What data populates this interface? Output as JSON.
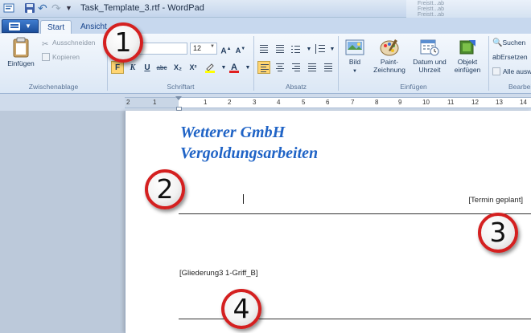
{
  "window": {
    "title": "Task_Template_3.rtf - WordPad",
    "bg_rows": [
      "Freistt...ab",
      "Freistt...ab",
      "Freistt...ab"
    ]
  },
  "quick_access": {
    "icons": [
      "wordpad-app-icon",
      "save-icon",
      "undo-icon",
      "redo-icon",
      "customize-dropdown-icon"
    ]
  },
  "tabs": {
    "start": "Start",
    "ansicht": "Ansicht"
  },
  "ribbon": {
    "clipboard": {
      "label": "Zwischenablage",
      "paste": "Einfügen",
      "cut": "Ausschneiden",
      "copy": "Kopieren"
    },
    "font": {
      "label": "Schriftart",
      "family": "",
      "size": "12",
      "bold": "F",
      "italic": "K",
      "underline": "U",
      "strike": "abc",
      "subscript": "X₂",
      "superscript": "X²",
      "grow": "A",
      "shrink": "A",
      "color_highlight": "#ffff00",
      "color_text": "#e02020"
    },
    "paragraph": {
      "label": "Absatz"
    },
    "insert": {
      "label": "Einfügen",
      "picture": "Bild",
      "paint_1": "Paint-",
      "paint_2": "Zeichnung",
      "datetime_1": "Datum und",
      "datetime_2": "Uhrzeit",
      "object_1": "Objekt",
      "object_2": "einfügen"
    },
    "editing": {
      "label": "Bearbeiten",
      "find": "Suchen",
      "replace": "Ersetzen",
      "select_all": "Alle auswählen"
    }
  },
  "ruler": {
    "numbers": [
      "2",
      "1",
      "1",
      "2",
      "3",
      "4",
      "5",
      "6",
      "7",
      "8",
      "9",
      "10",
      "11",
      "12",
      "13",
      "14"
    ]
  },
  "document": {
    "company": "Wetterer GmbH",
    "subtitle": "Vergoldungsarbeiten",
    "field_termin": "[Termin geplant]",
    "field_gliederung": "[Gliederung3 1-Griff_B]"
  },
  "callouts": [
    "1",
    "2",
    "3",
    "4"
  ]
}
